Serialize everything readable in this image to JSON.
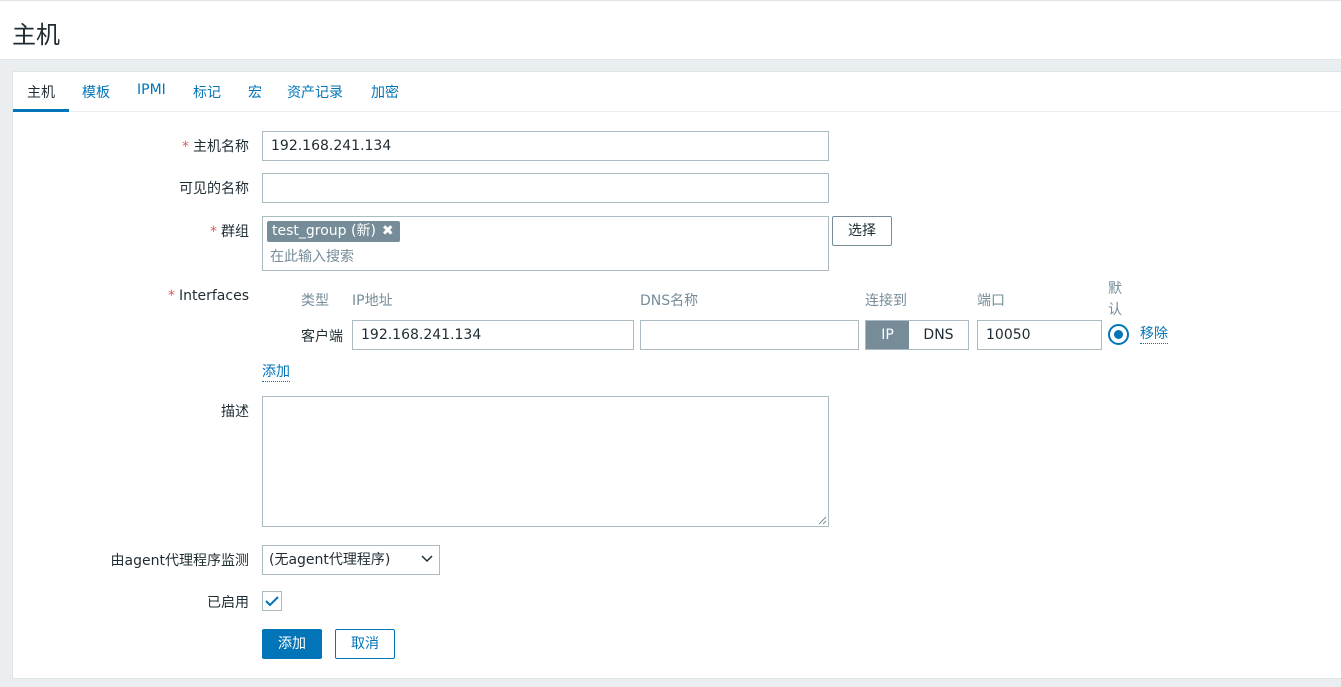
{
  "page": {
    "title": "主机"
  },
  "tabs": [
    {
      "label": "主机"
    },
    {
      "label": "模板"
    },
    {
      "label": "IPMI"
    },
    {
      "label": "标记"
    },
    {
      "label": "宏"
    },
    {
      "label": "资产记录"
    },
    {
      "label": "加密"
    }
  ],
  "form": {
    "host_name": {
      "label": "主机名称",
      "value": "192.168.241.134"
    },
    "visible_name": {
      "label": "可见的名称",
      "value": ""
    },
    "groups": {
      "label": "群组",
      "chip": "test_group (新)",
      "placeholder": "在此输入搜索",
      "select_button": "选择"
    },
    "interfaces": {
      "label": "Interfaces",
      "columns": {
        "type": "类型",
        "ip": "IP地址",
        "dns": "DNS名称",
        "connect_to": "连接到",
        "port": "端口",
        "default_line1": "默",
        "default_line2": "认"
      },
      "row": {
        "type": "客户端",
        "ip": "192.168.241.134",
        "dns": "",
        "connect_ip": "IP",
        "connect_dns": "DNS",
        "port": "10050",
        "remove": "移除"
      },
      "add_link": "添加"
    },
    "description": {
      "label": "描述",
      "value": ""
    },
    "monitored_by": {
      "label": "由agent代理程序监测",
      "value": "(无agent代理程序)"
    },
    "enabled": {
      "label": "已启用",
      "checked": true
    },
    "buttons": {
      "add": "添加",
      "cancel": "取消"
    }
  },
  "colors": {
    "accent": "#0275b8",
    "required": "#e45959",
    "chip": "#768d99"
  }
}
